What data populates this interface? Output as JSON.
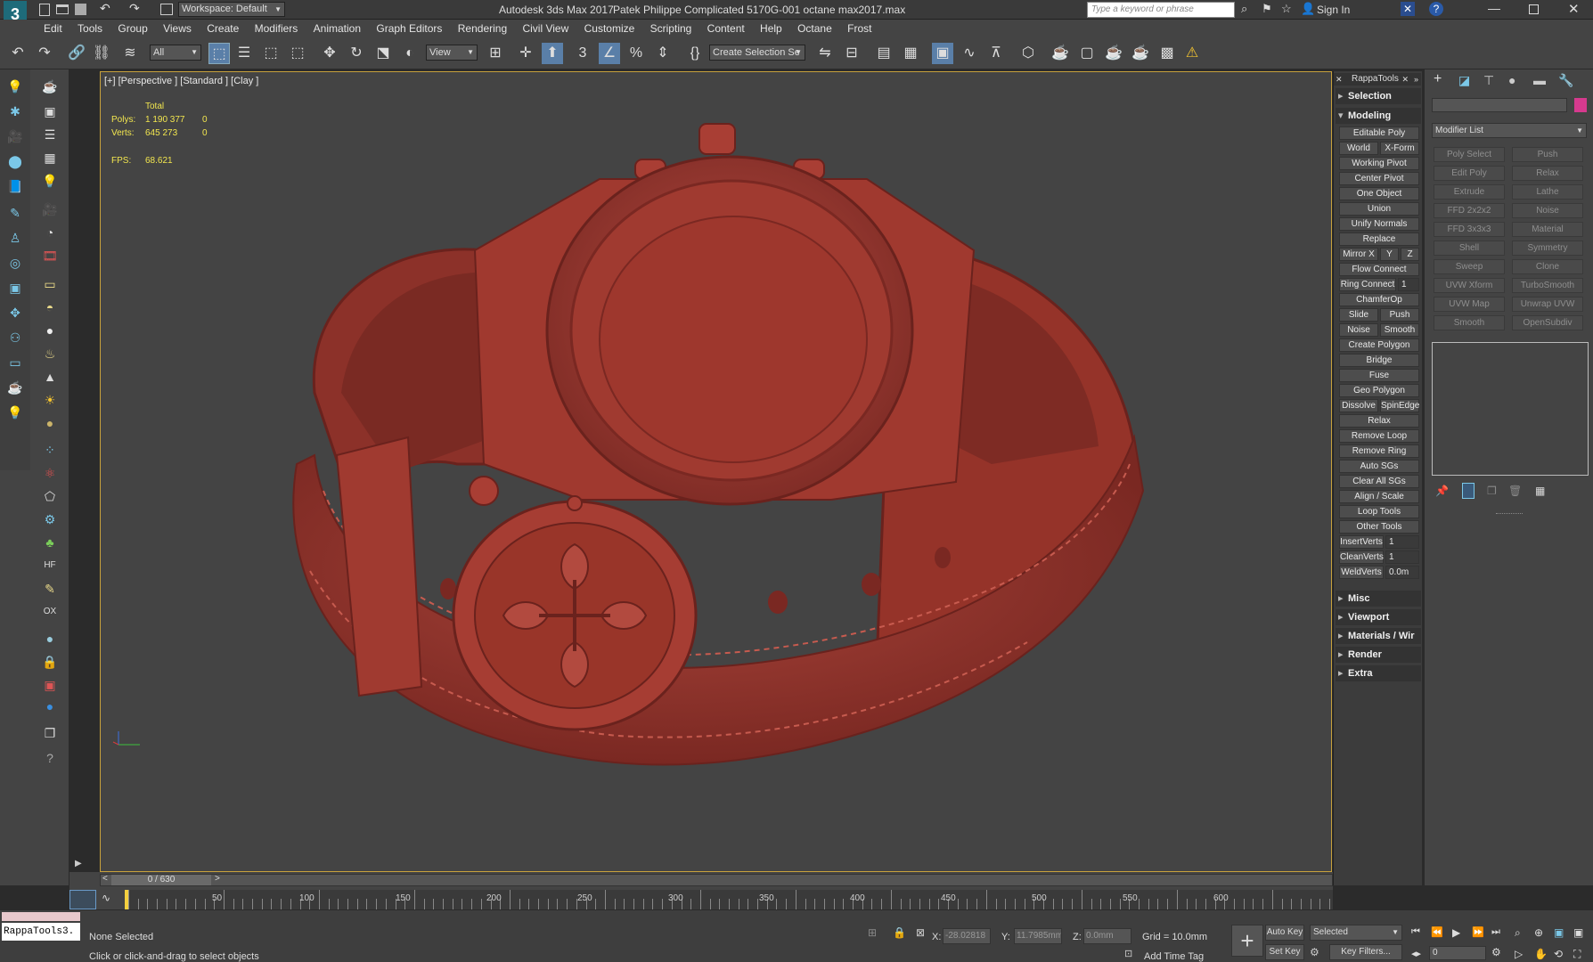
{
  "titlebar": {
    "workspace_label": "Workspace: Default",
    "app_title": "Autodesk 3ds Max 2017",
    "file_title": "Patek Philippe Complicated 5170G-001 octane max2017.max",
    "search_placeholder": "Type a keyword or phrase",
    "sign_in": "Sign In"
  },
  "menubar": {
    "items": [
      "Edit",
      "Tools",
      "Group",
      "Views",
      "Create",
      "Modifiers",
      "Animation",
      "Graph Editors",
      "Rendering",
      "Civil View",
      "Customize",
      "Scripting",
      "Content",
      "Help",
      "Octane",
      "Frost"
    ]
  },
  "toolbar": {
    "filter_value": "All",
    "coord_value": "View",
    "selection_set": "Create Selection Se"
  },
  "viewport": {
    "label": "[+] [Perspective ] [Standard ] [Clay ]",
    "stats": {
      "header": "Total",
      "polys_label": "Polys:",
      "polys_value": "1 190 377",
      "polys_sel": "0",
      "verts_label": "Verts:",
      "verts_value": "645 273",
      "verts_sel": "0",
      "fps_label": "FPS:",
      "fps_value": "68.621"
    }
  },
  "rappa": {
    "title": "RappaTools",
    "sections_top": [
      "Selection",
      "Modeling"
    ],
    "modeling": {
      "editable_poly": "Editable Poly",
      "world": "World",
      "xform": "X-Form",
      "working_pivot": "Working Pivot",
      "center_pivot": "Center Pivot",
      "one_object": "One Object",
      "union": "Union",
      "unify_normals": "Unify Normals",
      "replace": "Replace",
      "mirror_x": "Mirror X",
      "y": "Y",
      "z": "Z",
      "flow_connect": "Flow Connect",
      "ring_connect": "Ring Connect",
      "ring_value": "1",
      "chamferop": "ChamferOp",
      "slide": "Slide",
      "push": "Push",
      "noise": "Noise",
      "smooth": "Smooth",
      "create_polygon": "Create Polygon",
      "bridge": "Bridge",
      "fuse": "Fuse",
      "geo_polygon": "Geo Polygon",
      "dissolve": "Dissolve",
      "spinedge": "SpinEdge",
      "relax": "Relax",
      "remove_loop": "Remove Loop",
      "remove_ring": "Remove Ring",
      "auto_sgs": "Auto SGs",
      "clear_all_sgs": "Clear All SGs",
      "align_scale": "Align / Scale",
      "loop_tools": "Loop Tools",
      "other_tools": "Other Tools",
      "insertverts": "InsertVerts",
      "insert_value": "1",
      "cleanverts": "CleanVerts",
      "clean_value": "1",
      "weldverts": "WeldVerts",
      "weld_value": "0.0m"
    },
    "sections_bottom": [
      "Misc",
      "Viewport",
      "Materials / Wir",
      "Render",
      "Extra"
    ]
  },
  "cmdpanel": {
    "modifier_list": "Modifier List",
    "modifiers": [
      "Poly Select",
      "Push",
      "Edit Poly",
      "Relax",
      "Extrude",
      "Lathe",
      "FFD 2x2x2",
      "Noise",
      "FFD 3x3x3",
      "Material",
      "Shell",
      "Symmetry",
      "Sweep",
      "Clone",
      "UVW Xform",
      "TurboSmooth",
      "UVW Map",
      "Unwrap UVW",
      "Smooth",
      "OpenSubdiv"
    ]
  },
  "timeline": {
    "frame_label": "0 / 630",
    "ticks": [
      "50",
      "100",
      "150",
      "200",
      "250",
      "300",
      "350",
      "400",
      "450",
      "500",
      "550",
      "600"
    ]
  },
  "status": {
    "script_listener": "RappaTools3.",
    "selection": "None Selected",
    "prompt": "Click or click-and-drag to select objects",
    "x_label": "X:",
    "x_value": "-28.02818",
    "y_label": "Y:",
    "y_value": "11.7985mm",
    "z_label": "Z:",
    "z_value": "0.0mm",
    "grid": "Grid = 10.0mm",
    "add_time_tag": "Add Time Tag",
    "auto_key": "Auto Key",
    "set_key": "Set Key",
    "selected": "Selected",
    "key_filters": "Key Filters...",
    "frame_value": "0"
  }
}
